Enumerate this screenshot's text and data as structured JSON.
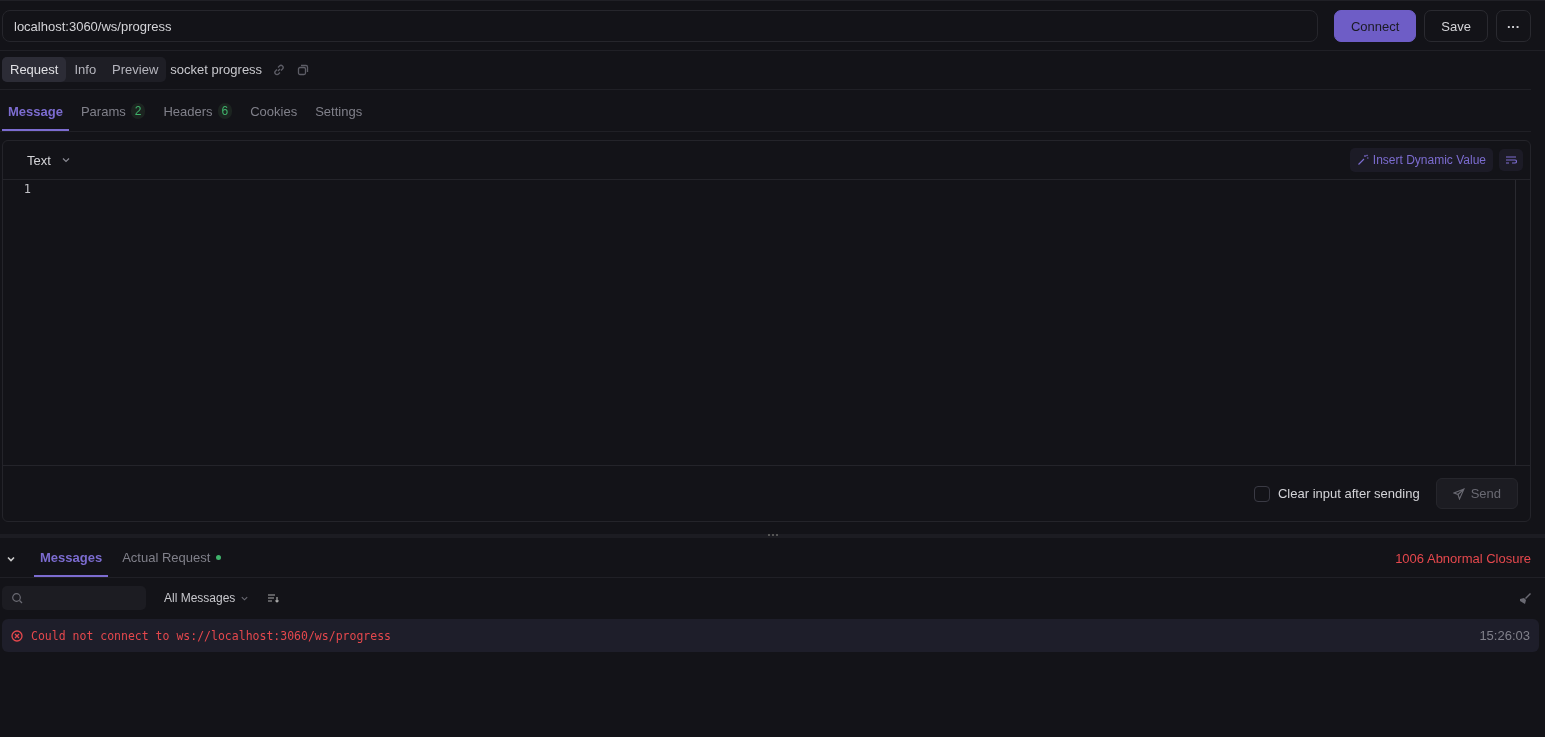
{
  "url_bar": {
    "value": "localhost:3060/ws/progress"
  },
  "actions": [
    {
      "label": "Connect",
      "kind": "primary"
    },
    {
      "label": "Save",
      "kind": "secondary"
    },
    {
      "label": "···",
      "kind": "more"
    }
  ],
  "view_tabs": [
    {
      "label": "Request",
      "selected": true
    },
    {
      "label": "Info",
      "selected": false
    },
    {
      "label": "Preview",
      "selected": false
    }
  ],
  "request_name": "socket progress",
  "tabs": [
    {
      "label": "Message",
      "selected": true
    },
    {
      "label": "Params",
      "selected": false,
      "count": "2"
    },
    {
      "label": "Headers",
      "selected": false,
      "count": "6"
    },
    {
      "label": "Cookies",
      "selected": false
    },
    {
      "label": "Settings",
      "selected": false
    }
  ],
  "editor": {
    "format": "Text",
    "insert_button": "Insert Dynamic Value",
    "line_numbers": [
      "1"
    ]
  },
  "clear_input": {
    "label": "Clear input after sending",
    "checked": false
  },
  "send_button": {
    "label": "Send",
    "disabled": true
  },
  "bottom_tabs": [
    {
      "label": "Messages",
      "selected": true,
      "dot": false
    },
    {
      "label": "Actual Request",
      "selected": false,
      "dot": true
    }
  ],
  "status": "1006 Abnormal Closure",
  "filter": {
    "dropdown": "All Messages"
  },
  "messages": [
    {
      "kind": "error",
      "text": "Could not connect to ws://localhost:3060/ws/progress",
      "time": "15:26:03"
    }
  ]
}
